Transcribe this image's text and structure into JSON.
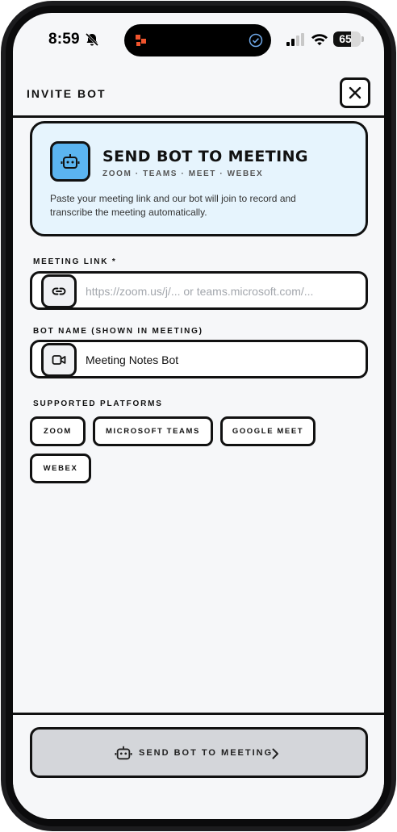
{
  "status_bar": {
    "time": "8:59",
    "battery": "65",
    "battery_level": 0.65,
    "icons": [
      "bell-slash-icon",
      "app-icon",
      "check-circle-icon",
      "signal-icon",
      "wifi-icon",
      "battery-icon"
    ]
  },
  "header": {
    "title": "INVITE BOT",
    "close_icon": "x-icon"
  },
  "hero": {
    "title": "SEND BOT TO MEETING",
    "subtitle": "ZOOM · TEAMS · MEET · WEBEX",
    "description": "Paste your meeting link and our bot will join to record and transcribe the meeting automatically.",
    "icon": "robot-icon",
    "background": "#e6f4fd",
    "accent": "#5bb4f0"
  },
  "meeting_link": {
    "label": "MEETING LINK *",
    "placeholder": "https://zoom.us/j/... or teams.microsoft.com/...",
    "value": "",
    "icon": "link-icon"
  },
  "bot_name": {
    "label": "BOT NAME (SHOWN IN MEETING)",
    "value": "Meeting Notes Bot",
    "icon": "video-icon"
  },
  "platforms": {
    "label": "SUPPORTED PLATFORMS",
    "items": [
      "ZOOM",
      "MICROSOFT TEAMS",
      "GOOGLE MEET",
      "WEBEX"
    ]
  },
  "footer": {
    "button_label": "SEND BOT TO MEETING",
    "button_icon": "robot-icon",
    "chevron_icon": "chevron-right-icon",
    "button_color": "#d4d6da"
  }
}
